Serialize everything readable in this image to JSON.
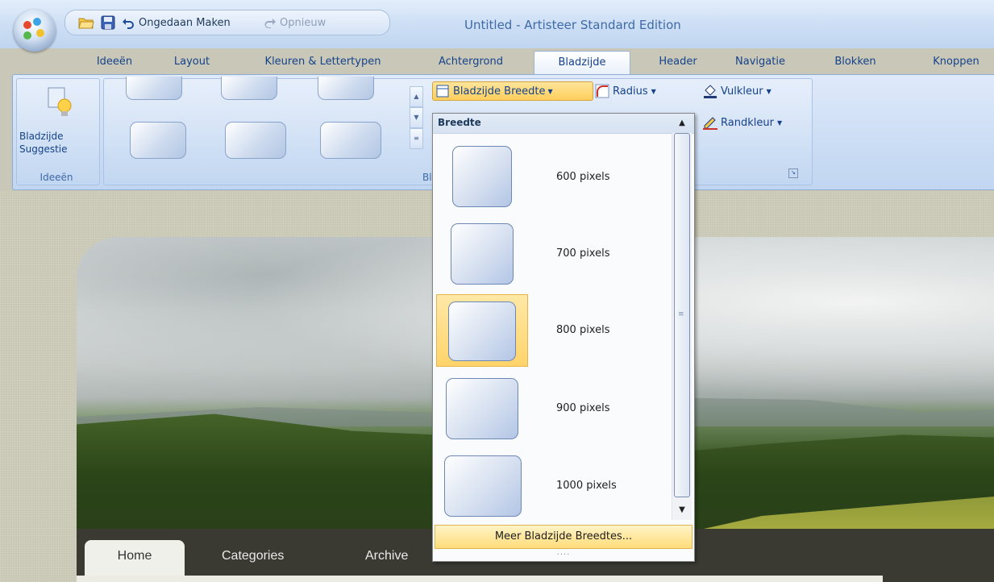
{
  "window": {
    "title": "Untitled - Artisteer Standard Edition"
  },
  "qat": {
    "undo_label": "Ongedaan Maken",
    "redo_label": "Opnieuw"
  },
  "tabs": [
    "Ideeën",
    "Layout",
    "Kleuren & Lettertypen",
    "Achtergrond",
    "Bladzijde",
    "Header",
    "Navigatie",
    "Blokken",
    "Knoppen"
  ],
  "active_tab": "Bladzijde",
  "ribbon": {
    "suggest_label_1": "Bladzijde",
    "suggest_label_2": "Suggestie",
    "group_ideas": "Ideeën",
    "group_page_partial": "Bl",
    "page_width_button": "Bladzijde Breedte",
    "radius_button": "Radius",
    "fill_color_button": "Vulkleur",
    "border_color_button": "Randkleur"
  },
  "dropdown": {
    "header": "Breedte",
    "items": [
      "600 pixels",
      "700 pixels",
      "800 pixels",
      "900 pixels",
      "1000 pixels"
    ],
    "selected": "800 pixels",
    "more_label": "Meer Bladzijde Breedtes..."
  },
  "preview_nav": [
    "Home",
    "Categories",
    "Archive"
  ],
  "icons": [
    "office-orb-icon",
    "open-folder-icon",
    "save-icon",
    "undo-icon",
    "redo-icon",
    "lightbulb-icon",
    "page-width-icon",
    "radius-icon",
    "fill-bucket-icon",
    "pencil-icon",
    "dialog-launcher-icon"
  ]
}
